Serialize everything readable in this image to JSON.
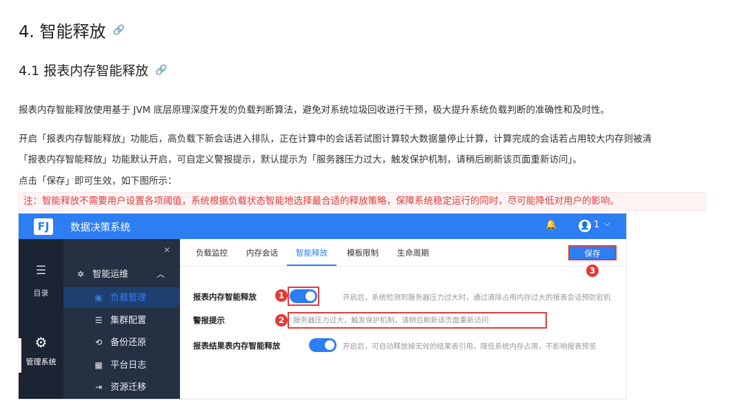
{
  "doc": {
    "h2": "4. 智能释放",
    "h3": "4.1 报表内存智能释放",
    "link_icon": "🔗",
    "p1": "报表内存智能释放使用基于 JVM 底层原理深度开发的负载判断算法，避免对系统垃圾回收进行干预，极大提升系统负载判断的准确性和及时性。",
    "p2a": "开启「报表内存智能释放」功能后，高负载下新会话进入排队，正在计算中的会话若试图计算较大数据量停止计算，计算完成的会话若占用较大内存则被清",
    "p2b": "「报表内存智能释放」功能默认开启，可自定义警报提示，默认提示为「服务器压力过大，触发保护机制，请稍后刷新该页面重新访问」。",
    "p3": "点击「保存」即可生效，如下图所示：",
    "note": "注：智能释放不需要用户设置各项阈值，系统根据负载状态智能地选择最合适的释放策略，保障系统稳定运行的同时，尽可能降低对用户的影响。"
  },
  "shot": {
    "logo": "FJ",
    "app_title": "数据决策系统",
    "bell": "🔔",
    "avatar": "👤",
    "user_num": "1",
    "chevron": "⌵",
    "rail": [
      {
        "icon": "☰",
        "label": "目录"
      },
      {
        "icon": "⚙",
        "label": "管理系统"
      }
    ],
    "pin": "✕",
    "menu": {
      "group": "智能运维",
      "group_icon": "✲",
      "group_chev": "︿",
      "items": [
        {
          "icon": "▣",
          "label": "负载管理"
        },
        {
          "icon": "☰",
          "label": "集群配置"
        },
        {
          "icon": "⟲",
          "label": "备份还原"
        },
        {
          "icon": "▦",
          "label": "平台日志"
        },
        {
          "icon": "⇥",
          "label": "资源迁移"
        }
      ]
    },
    "tabs": [
      "负载监控",
      "内存会话",
      "智能释放",
      "模板限制",
      "生命周期"
    ],
    "save": "保存",
    "rows": [
      {
        "label": "报表内存智能释放",
        "hint": "开启后，系统检测到服务器压力过大时，通过清除占用内存过大的报表会话预防宕机"
      },
      {
        "label": "警报提示",
        "placeholder": "服务器压力过大，触发保护机制，请稍后刷新该页面重新访问"
      },
      {
        "label": "报表结果表内存智能释放",
        "hint": "开启后，可自动释放掉无效的结果表引用，降低系统内存占用，不影响报表预览"
      }
    ],
    "badges": [
      "1",
      "2",
      "3"
    ],
    "drag": "⋮"
  }
}
